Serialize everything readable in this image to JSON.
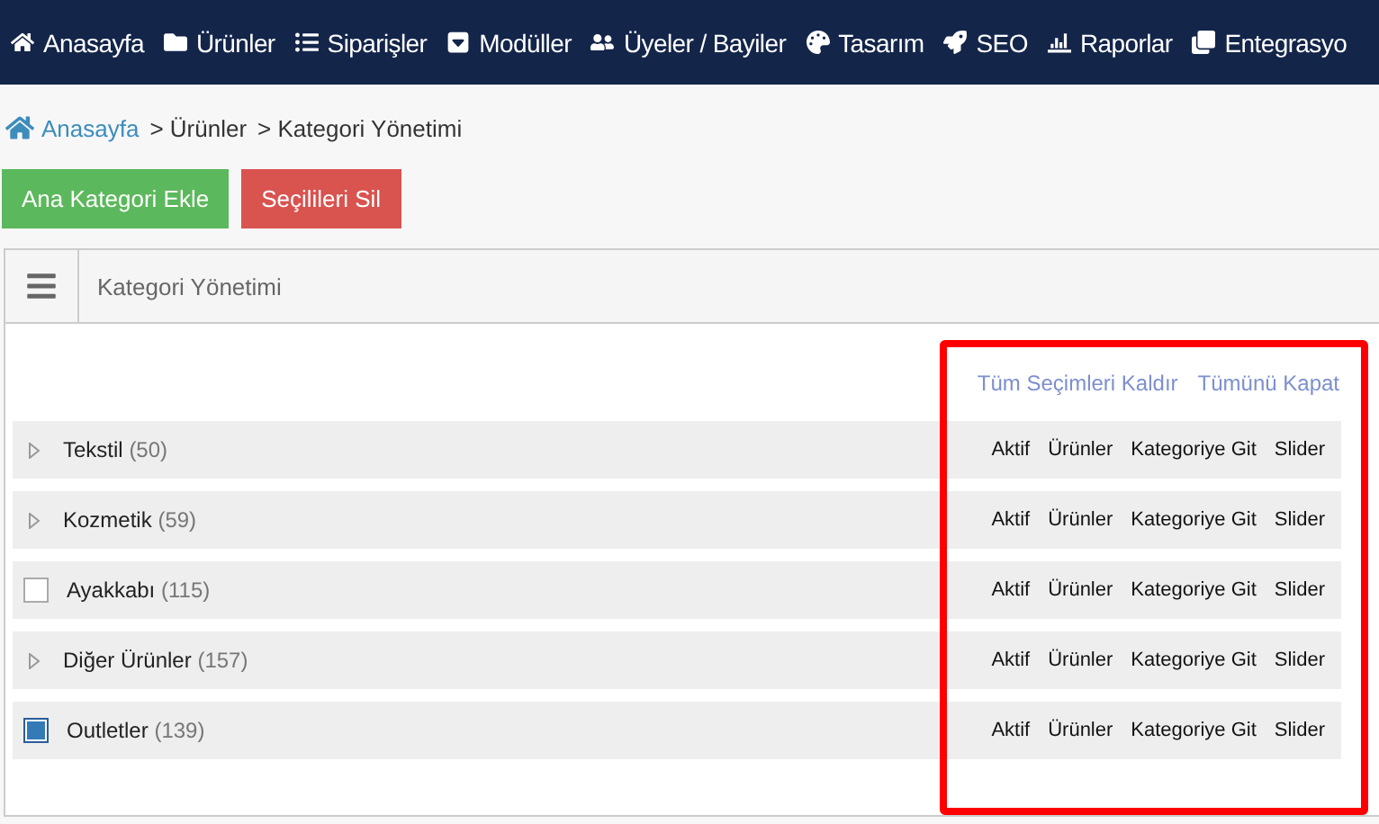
{
  "nav": {
    "items": [
      "Anasayfa",
      "Ürünler",
      "Siparişler",
      "Modüller",
      "Üyeler / Bayiler",
      "Tasarım",
      "SEO",
      "Raporlar",
      "Entegrasyo"
    ]
  },
  "breadcrumb": {
    "home": "Anasayfa",
    "parts": [
      "> Ürünler",
      "> Kategori Yönetimi"
    ]
  },
  "actions": [
    {
      "label": "Ana Kategori Ekle",
      "kind": "success"
    },
    {
      "label": "Seçilileri Sil",
      "kind": "danger"
    }
  ],
  "panel": {
    "title": "Kategori Yönetimi",
    "links": [
      "Tüm Seçimleri Kaldır",
      "Tümünü Kapat"
    ],
    "rows": [
      {
        "kind": "expandable",
        "name": "Tekstil",
        "count": "(50)",
        "actions": [
          "Aktif",
          "Ürünler",
          "Kategoriye Git",
          "Slider"
        ]
      },
      {
        "kind": "expandable",
        "name": "Kozmetik",
        "count": "(59)",
        "actions": [
          "Aktif",
          "Ürünler",
          "Kategoriye Git",
          "Slider"
        ]
      },
      {
        "kind": "checkbox",
        "checked": false,
        "name": "Ayakkabı",
        "count": "(115)",
        "actions": [
          "Aktif",
          "Ürünler",
          "Kategoriye Git",
          "Slider"
        ]
      },
      {
        "kind": "expandable",
        "name": "Diğer Ürünler",
        "count": "(157)",
        "actions": [
          "Aktif",
          "Ürünler",
          "Kategoriye Git",
          "Slider"
        ]
      },
      {
        "kind": "checkbox",
        "checked": true,
        "name": "Outletler",
        "count": "(139)",
        "actions": [
          "Aktif",
          "Ürünler",
          "Kategoriye Git",
          "Slider"
        ]
      }
    ]
  },
  "highlight": {
    "color": "#ff0000"
  }
}
